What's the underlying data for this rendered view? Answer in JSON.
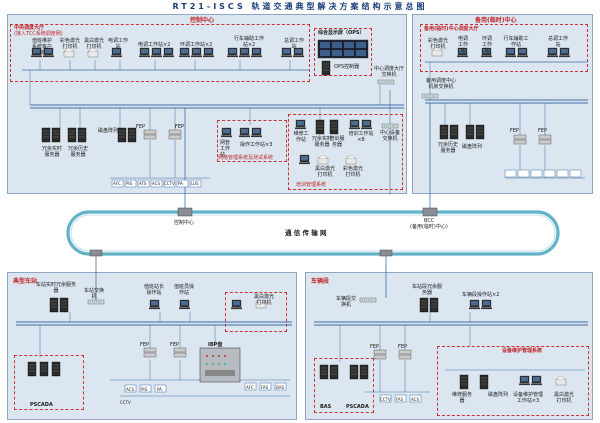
{
  "title": "RT21-ISCS 轨道交通典型解决方案结构示意总图",
  "control_center": {
    "title": "控制中心",
    "dispatch_hall": "中央调度大厅",
    "dispatch_note": "(接入TCC系统调度网)",
    "users": [
      "值班维护系统客户端",
      "彩色激光打印机",
      "黑白激光打印机",
      "电调工作站",
      "电调工作站×2",
      "环调工作站×2",
      "行车辅助工作站×2",
      "总调工作站"
    ],
    "ops": "综合显示屏（OPS）",
    "ops_ctrl": "OPS控制器",
    "core_switch": "中心调度大厅交换机",
    "servers": [
      "冗余实时服务器",
      "冗余历史服务器",
      "磁盘阵列"
    ],
    "fep": [
      "FEP",
      "FEP"
    ],
    "network_mgmt": "网络管理系统及测试系统",
    "network_items": [
      "网管工作站",
      "操作工作站×3"
    ],
    "training": "培训管理系统",
    "training_items": [
      "维修工作站",
      "冗余实时服务器",
      "培训服务器",
      "培训工作站×8",
      "黑白激光打印机",
      "彩色激光打印机",
      "中心设备交换机"
    ],
    "lan_label": "中心设备交换机"
  },
  "backup_center": {
    "title": "备用(临时)中心",
    "hall": "备用(临时)中心调度大厅",
    "users": [
      "彩色激光打印机",
      "电调工作站",
      "环调工作站",
      "行车辅助工作站",
      "总调工作站"
    ],
    "switch": "备用调度中心机房交换机",
    "servers": [
      "冗余历史服务器",
      "磁盘阵列"
    ],
    "fep": [
      "FEP",
      "FEP"
    ]
  },
  "ring": {
    "label": "通 信 传 输 网",
    "control_node": "控制中心",
    "bcc_node": "BCC",
    "bcc_sub": "(备用(临时)中心)"
  },
  "station": {
    "title": "典型车站",
    "servers": [
      "车站实时冗余服务器"
    ],
    "switch": "车站交换机",
    "workstations": [
      "值班站长操作站",
      "值班员操作站",
      "黑白激光打印机"
    ],
    "ibp": "IBP盘",
    "fep": [
      "FEP",
      "FEP"
    ],
    "pscada": "PSCADA",
    "subsystems": [
      "AFC",
      "FAS",
      "BAS",
      "ACS",
      "PIS",
      "PA",
      "CCTV"
    ]
  },
  "depot": {
    "title": "车辆段",
    "switch": "车辆段交换机",
    "servers": [
      "车站段冗余服务器"
    ],
    "workstations": [
      "车辆段操作站×2"
    ],
    "fep": [
      "FEP",
      "FEP"
    ],
    "maint_title": "设备维护管理系统",
    "maint_items": [
      "维修服务器",
      "磁盘阵列",
      "设备维护管理工作站×3",
      "黑白激光打印机"
    ],
    "bas": "BAS",
    "pscada": "PSCADA",
    "subsystems": [
      "CCTV",
      "FAS",
      "ACS"
    ]
  },
  "subsystem_bus": [
    "AFC",
    "PIS",
    "ATS",
    "ACS",
    "CCTV",
    "PA",
    "LUS"
  ],
  "colors": {
    "panel": "#dce6f0",
    "line": "#3c6ea8",
    "red": "#c0262a",
    "ring": "#62b3c8"
  }
}
